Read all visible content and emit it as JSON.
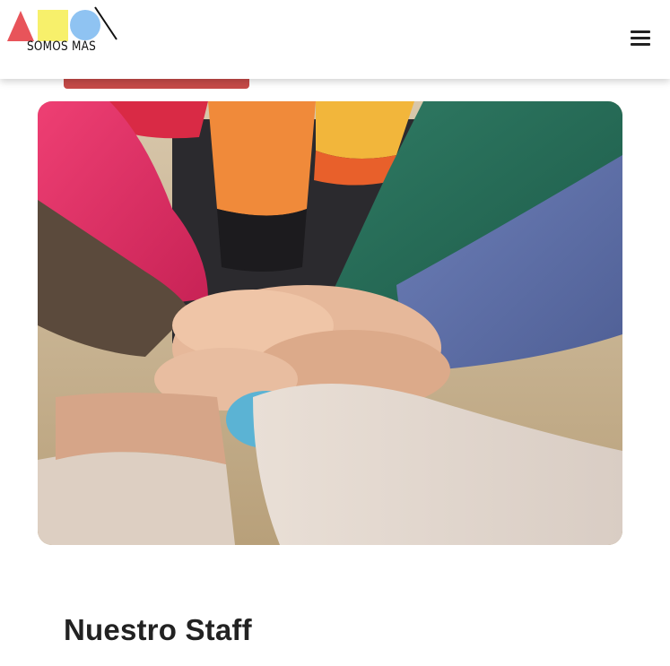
{
  "header": {
    "logo_text": "SOMOS MAS",
    "menu_icon": "hamburger-icon"
  },
  "hero": {
    "image_subject": "stacked-hands-team-photo"
  },
  "section": {
    "title": "Nuestro Staff"
  },
  "colors": {
    "brand_red": "#e8545a",
    "brand_yellow": "#f7f06b",
    "brand_blue": "#8fc3f2",
    "button_red": "#c64a48",
    "text_dark": "#222222"
  }
}
